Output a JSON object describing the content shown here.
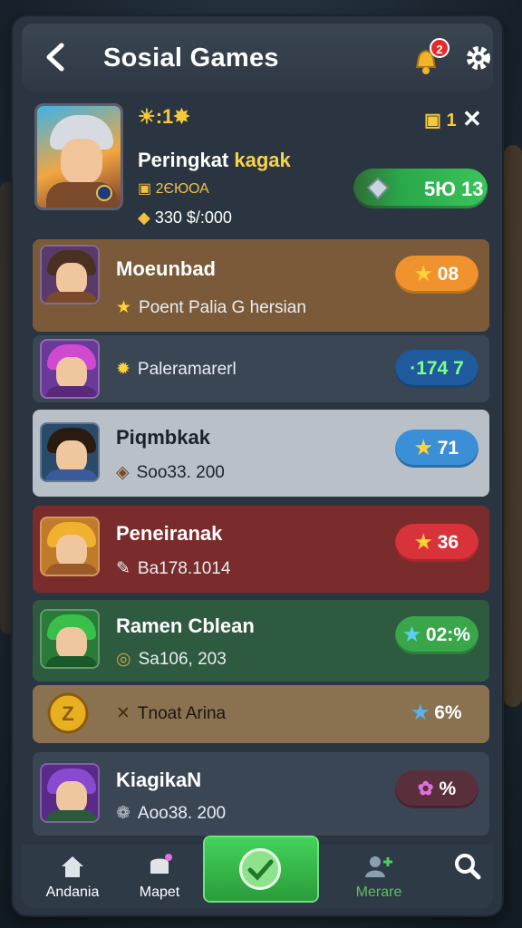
{
  "header": {
    "title": "Sosial Games",
    "notification_badge": "2",
    "back_icon": "chevron-left-icon",
    "bell_icon": "bell-icon",
    "settings_icon": "gear-icon"
  },
  "profile": {
    "top_icons": "☀:1✸",
    "rank_label": "Peringkat",
    "rank_highlight": "kagak",
    "sub_text": "2ЄЮОА",
    "coins_text": "330 $/:000",
    "top_right_value": "1",
    "close_label": "✕",
    "pill_value": "5Ю 13",
    "pill_color": "#2aa84a"
  },
  "rows": [
    {
      "name": "Moeunbad",
      "sub": "Poent Palia G hersian",
      "value": "08",
      "pill_color": "#f0922e",
      "bg": "#7a5a38"
    },
    {
      "name": "",
      "sub": "Paleramarerl",
      "value": "·174 7",
      "pill_color": "#1e5a9c",
      "bg": "#3b4654"
    },
    {
      "name": "Piqmbkak",
      "sub": "Soo33. 200",
      "value": "71",
      "pill_color": "#3a8fd6",
      "bg": "#b9c0c8"
    },
    {
      "name": "Peneiranak",
      "sub": "Ba178.1014",
      "value": "36",
      "pill_color": "#d8333a",
      "bg": "#7a2c2c"
    },
    {
      "name": "Ramen Cblean",
      "sub": "Sa106, 203",
      "value": "02:%",
      "pill_color": "#3aa64a",
      "bg": "#2e5a40"
    },
    {
      "name": "",
      "sub": "Tnoat Arina",
      "value": "6%",
      "pill_color": "transparent",
      "bg": "#8a7250"
    },
    {
      "name": "KiagikaN",
      "sub": "Aoo38. 200",
      "value": "%",
      "pill_color": "#5a2f3c",
      "bg": "#3b4654"
    }
  ],
  "nav": {
    "items": [
      {
        "label": "Andania",
        "icon": "home-icon"
      },
      {
        "label": "Mapet",
        "icon": "map-icon"
      },
      {
        "label": "",
        "icon": "check-icon"
      },
      {
        "label": "Merare",
        "icon": "add-friend-icon"
      },
      {
        "label": "",
        "icon": "search-icon"
      }
    ]
  }
}
